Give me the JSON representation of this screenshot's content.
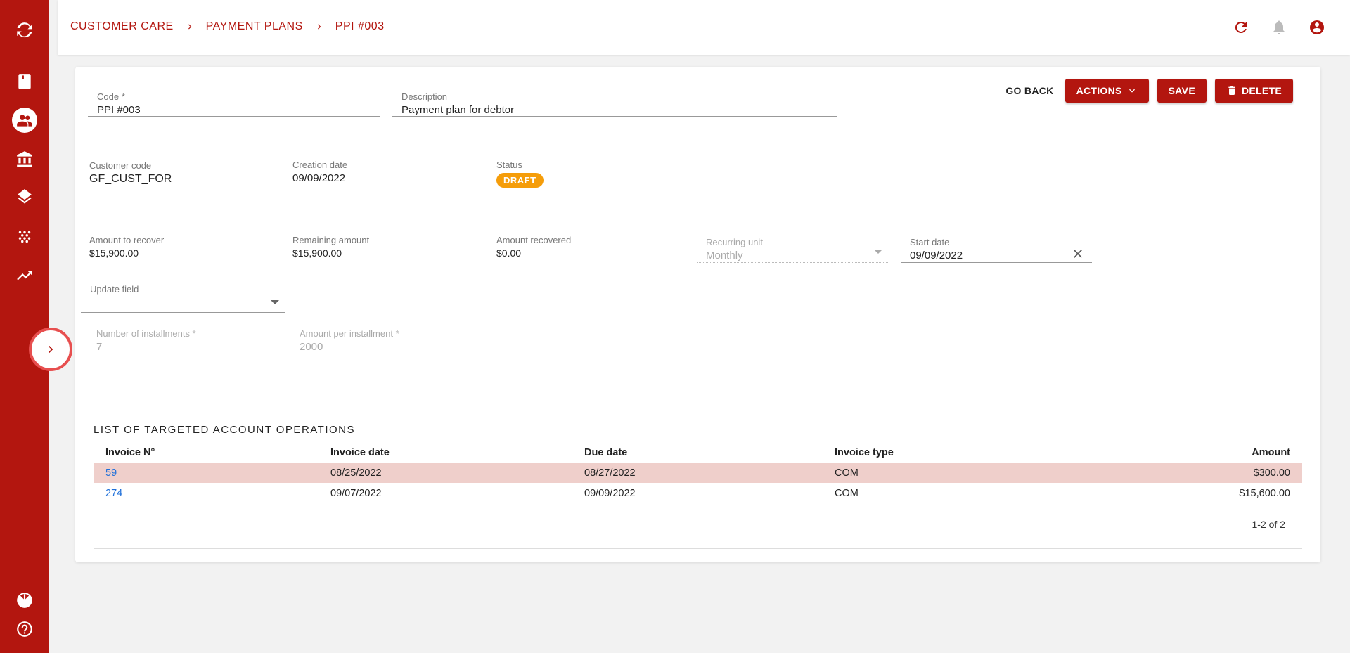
{
  "breadcrumb": [
    "CUSTOMER CARE",
    "PAYMENT PLANS",
    "PPI #003"
  ],
  "buttons": {
    "go_back": "GO BACK",
    "actions": "ACTIONS",
    "save": "SAVE",
    "delete": "DELETE"
  },
  "form": {
    "code": {
      "label": "Code *",
      "value": "PPI #003"
    },
    "description": {
      "label": "Description",
      "value": "Payment plan for debtor"
    },
    "customer_code": {
      "label": "Customer code",
      "value": "GF_CUST_FOR"
    },
    "creation_date": {
      "label": "Creation date",
      "value": "09/09/2022"
    },
    "status": {
      "label": "Status",
      "value": "DRAFT"
    },
    "amount_to_recover": {
      "label": "Amount to recover",
      "value": "$15,900.00"
    },
    "remaining_amount": {
      "label": "Remaining amount",
      "value": "$15,900.00"
    },
    "amount_recovered": {
      "label": "Amount recovered",
      "value": "$0.00"
    },
    "recurring_unit": {
      "label": "Recurring unit",
      "value": "Monthly"
    },
    "start_date": {
      "label": "Start date",
      "value": "09/09/2022"
    },
    "update_field": {
      "label": "Update field",
      "value": ""
    },
    "number_of_installments": {
      "label": "Number of installments *",
      "value": "7"
    },
    "amount_per_installment": {
      "label": "Amount per installment *",
      "value": "2000"
    }
  },
  "operations": {
    "title": "LIST OF TARGETED ACCOUNT OPERATIONS",
    "columns": [
      "Invoice N°",
      "Invoice date",
      "Due date",
      "Invoice type",
      "Amount"
    ],
    "rows": [
      {
        "invoice": "59",
        "invoice_date": "08/25/2022",
        "due_date": "08/27/2022",
        "type": "COM",
        "amount": "$300.00"
      },
      {
        "invoice": "274",
        "invoice_date": "09/07/2022",
        "due_date": "09/09/2022",
        "type": "COM",
        "amount": "$15,600.00"
      }
    ],
    "pagination": "1-2 of 2"
  },
  "colors": {
    "primary": "#b3160f",
    "draft_badge": "#f59d0a",
    "link": "#1e6fd9",
    "row_highlight": "#efcfcb"
  },
  "icons": {
    "sidebar": [
      "app-logo-icon",
      "book-icon",
      "customers-icon",
      "bank-icon",
      "layers-icon",
      "dots-grid-icon",
      "trending-up-icon",
      "language-flag-icon",
      "help-icon"
    ],
    "topbar": [
      "refresh-icon",
      "bell-icon",
      "account-icon"
    ]
  }
}
